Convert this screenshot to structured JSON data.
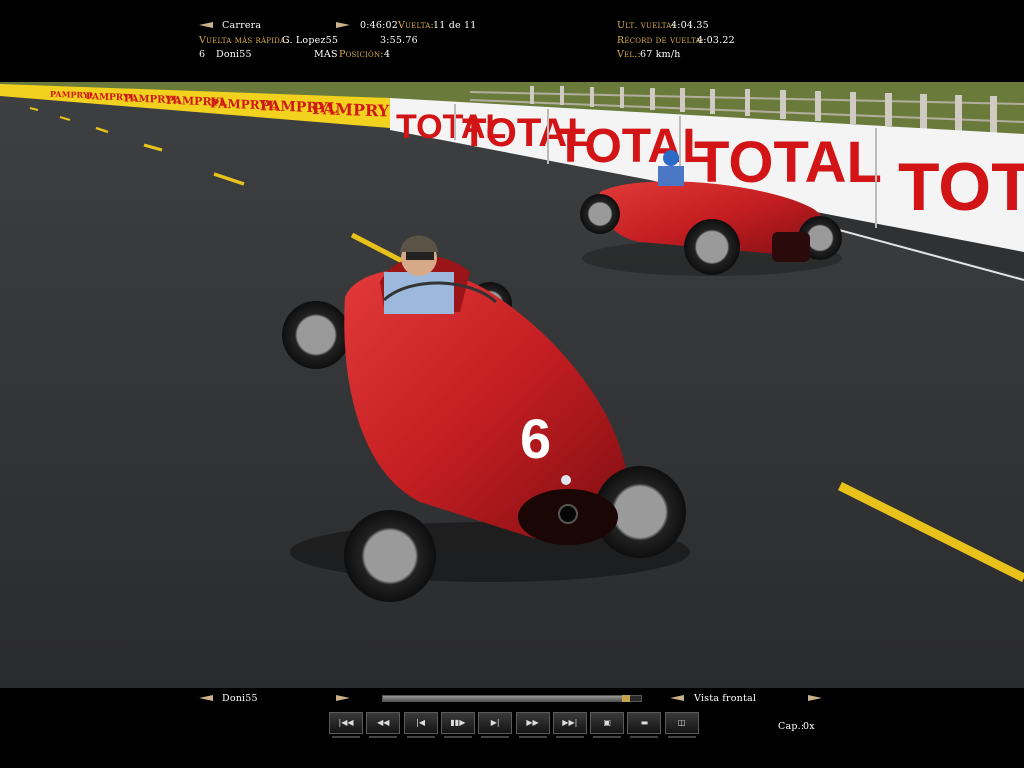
{
  "hud": {
    "session_label": "Carrera",
    "time": "0:46:02",
    "lap_label": "Vuelta:",
    "lap_value": "11 de 11",
    "fastest_lap_label": "Vuelta más rápida:",
    "fastest_lap_driver": "G. Lopez55",
    "fastest_lap_time": "3:55.76",
    "last_lap_label": "Ult. vuelta:",
    "last_lap_time": "4:04.35",
    "lap_record_label": "Récord de vuelta:",
    "lap_record_time": "4:03.22",
    "car_number": "6",
    "driver": "Doni55",
    "team": "MAS",
    "position_label": "Posición:",
    "position_value": "4",
    "speed_label": "Vel.:",
    "speed_value": "67 km/h"
  },
  "scene": {
    "banner_pampryl": "PAMPRYL",
    "banner_total": "TOTAL",
    "car_number": "6"
  },
  "replay": {
    "driver": "Doni55",
    "camera": "Vista frontal",
    "capture_label": "Cap.:",
    "capture_value": "0x",
    "progress_fraction": 0.95,
    "buttons": [
      {
        "name": "skip-start-button",
        "glyph": "|◀◀"
      },
      {
        "name": "rewind-button",
        "glyph": "◀◀"
      },
      {
        "name": "step-back-button",
        "glyph": "|◀"
      },
      {
        "name": "pause-button",
        "glyph": "▮▮▶"
      },
      {
        "name": "step-forward-button",
        "glyph": "▶|"
      },
      {
        "name": "fast-forward-button",
        "glyph": "▶▶"
      },
      {
        "name": "skip-end-button",
        "glyph": "▶▶|"
      },
      {
        "name": "camera-button",
        "glyph": "▣"
      },
      {
        "name": "folder-button",
        "glyph": "▬"
      },
      {
        "name": "save-button",
        "glyph": "◫"
      }
    ]
  }
}
